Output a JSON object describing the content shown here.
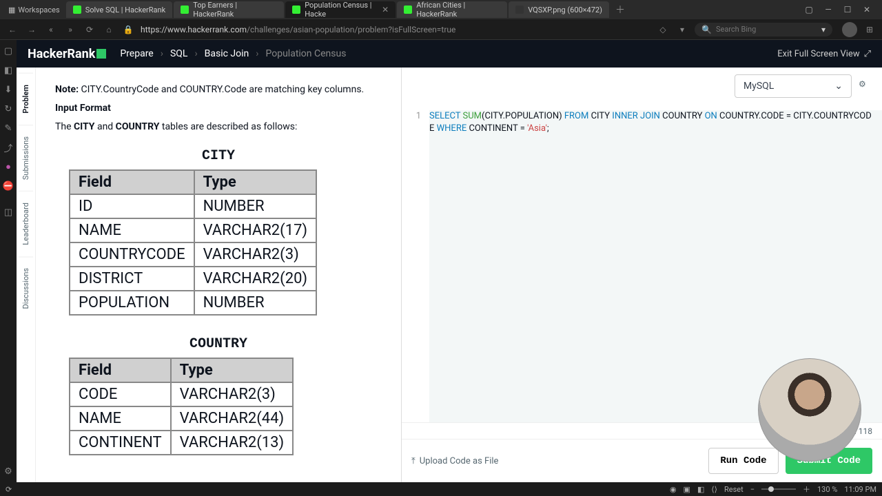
{
  "browser": {
    "workspaces_label": "Workspaces",
    "tabs": [
      {
        "title": "Solve SQL | HackerRank"
      },
      {
        "title": "Top Earners | HackerRank"
      },
      {
        "title": "Population Census | Hacke"
      },
      {
        "title": "African Cities | HackerRank"
      },
      {
        "title": "VQSXP.png (600×472)"
      }
    ],
    "url_host": "https://www.hackerrank.com",
    "url_path": "/challenges/asian-population/problem?isFullScreen=true",
    "search_placeholder": "Search Bing"
  },
  "app_header": {
    "logo": "HackerRank",
    "crumbs": [
      "Prepare",
      "SQL",
      "Basic Join",
      "Population Census"
    ],
    "exit_label": "Exit Full Screen View"
  },
  "side_tabs": [
    "Problem",
    "Submissions",
    "Leaderboard",
    "Discussions"
  ],
  "problem": {
    "note_label": "Note:",
    "note_text": " CITY.CountryCode and COUNTRY.Code are matching key columns.",
    "input_format": "Input Format",
    "desc_pre": "The ",
    "desc_city": "CITY",
    "desc_mid": " and ",
    "desc_country": "COUNTRY",
    "desc_post": " tables are described as follows:",
    "city_caption": "CITY",
    "country_caption": "COUNTRY",
    "th_field": "Field",
    "th_type": "Type",
    "city_rows": [
      [
        "ID",
        "NUMBER"
      ],
      [
        "NAME",
        "VARCHAR2(17)"
      ],
      [
        "COUNTRYCODE",
        "VARCHAR2(3)"
      ],
      [
        "DISTRICT",
        "VARCHAR2(20)"
      ],
      [
        "POPULATION",
        "NUMBER"
      ]
    ],
    "country_rows": [
      [
        "CODE",
        "VARCHAR2(3)"
      ],
      [
        "NAME",
        "VARCHAR2(44)"
      ],
      [
        "CONTINENT",
        "VARCHAR2(13)"
      ]
    ]
  },
  "editor": {
    "language": "MySQL",
    "line_no": "1",
    "code_parts": {
      "select": "SELECT",
      "sum": "SUM",
      "p1": "(CITY.POPULATION) ",
      "from": "FROM",
      "p2": " CITY ",
      "inner": "INNER",
      "join": "JOIN",
      "p3": " COUNTRY ",
      "on": "ON",
      "p4": " COUNTRY.CODE = CITY.COUNTRYCODE ",
      "where": "WHERE",
      "p5": " CONTINENT = ",
      "str": "'Asia'",
      "p6": ";"
    },
    "cursor_status": "Line: 1 Col: 118",
    "upload_label": "Upload Code as File",
    "run_label": "Run Code",
    "submit_label": "Submit Code"
  },
  "status_bar": {
    "reset": "Reset",
    "zoom": "130 %",
    "time": "11:09 PM"
  }
}
